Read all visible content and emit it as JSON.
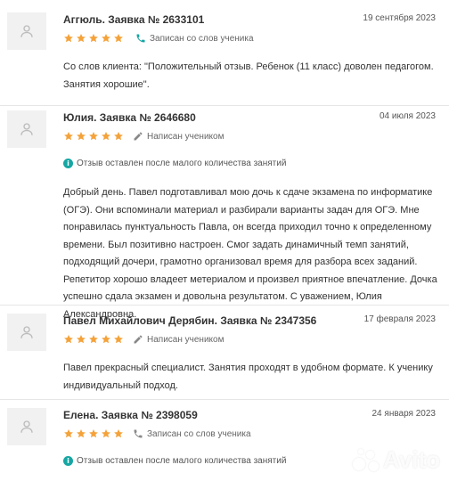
{
  "colors": {
    "star": "#f4a23a",
    "accent": "#16a6a3",
    "avatar_bg": "#f1f1f1"
  },
  "reviews": [
    {
      "name": "Аггюль. Заявка № 2633101",
      "date": "19 сентября 2023",
      "rating": 5,
      "source_icon": "phone-icon",
      "source": "Записан со слов ученика",
      "text": "Со слов клиента: \"Положительный отзыв. Ребенок (11 класс) доволен педагогом. Занятия хорошие\"."
    },
    {
      "name": "Юлия. Заявка № 2646680",
      "date": "04 июля 2023",
      "rating": 5,
      "source_icon": "pencil-icon",
      "source": "Написан учеником",
      "note": "Отзыв оставлен после малого количества занятий",
      "text": "Добрый день. Павел подготавливал мою дочь к сдаче экзамена по информатике (ОГЭ). Они вспоминали материал и разбирали варианты задач для ОГЭ. Мне понравилась пунктуальность Павла, он всегда приходил точно к определенному времени. Был позитивно настроен. Смог задать динамичный темп занятий, подходящий дочери, грамотно организовал время для разбора всех заданий. Репетитор хорошо владеет метериалом и произвел приятное впечатление. Дочка успешно сдала экзамен и довольна результатом. С уважением, Юлия Александровна."
    },
    {
      "name": "Павел Михайлович Дерябин. Заявка № 2347356",
      "date": "17 февраля 2023",
      "rating": 5,
      "source_icon": "pencil-icon",
      "source": "Написан учеником",
      "text": "Павел прекрасный специалист. Занятия проходят в удобном формате. К ученику индивидуальный подход."
    },
    {
      "name": "Елена. Заявка № 2398059",
      "date": "24 января 2023",
      "rating": 5,
      "source_icon": "phone-icon",
      "source": "Записан со слов ученика",
      "note": "Отзыв оставлен после малого количества занятий"
    }
  ],
  "watermark": "Avito"
}
